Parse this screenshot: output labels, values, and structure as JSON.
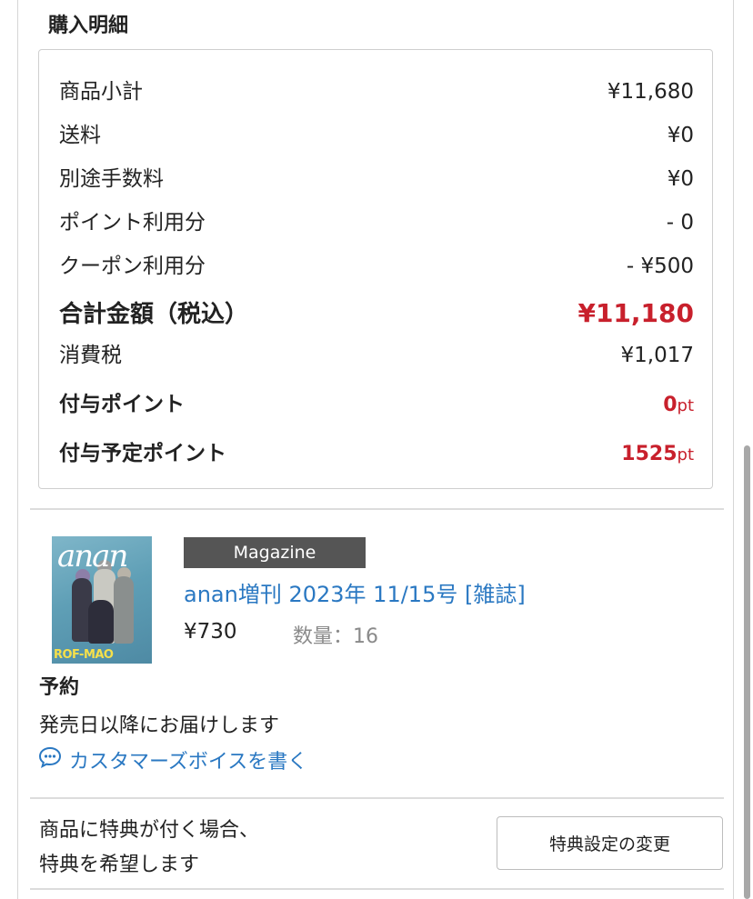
{
  "section_title": "購入明細",
  "summary": {
    "subtotal_label": "商品小計",
    "subtotal_value": "¥11,680",
    "shipping_label": "送料",
    "shipping_value": "¥0",
    "fee_label": "別途手数料",
    "fee_value": "¥0",
    "points_used_label": "ポイント利用分",
    "points_used_value": "- 0",
    "coupon_label": "クーポン利用分",
    "coupon_value": "- ¥500",
    "total_label": "合計金額（税込）",
    "total_value": "¥11,180",
    "tax_label": "消費税",
    "tax_value": "¥1,017",
    "granted_points_label": "付与ポイント",
    "granted_points_value": "0",
    "granted_points_unit": "pt",
    "scheduled_points_label": "付与予定ポイント",
    "scheduled_points_value": "1525",
    "scheduled_points_unit": "pt"
  },
  "product": {
    "thumbnail_logo": "anan",
    "thumbnail_brand": "ROF-MAO",
    "badge": "Magazine",
    "title": "anan増刊 2023年 11/15号 [雑誌]",
    "price": "¥730",
    "quantity": "数量：16",
    "reserve_label": "予約",
    "reserve_note": "発売日以降にお届けします",
    "review_link": "カスタマーズボイスを書く"
  },
  "bonus": {
    "line1": "商品に特典が付く場合、",
    "line2": "特典を希望します",
    "button_label": "特典設定の変更"
  },
  "colors": {
    "accent_red": "#c8202c",
    "link_blue": "#2a78c2",
    "badge_gray": "#555555"
  },
  "icons": {
    "review": "speech-bubble-icon"
  }
}
